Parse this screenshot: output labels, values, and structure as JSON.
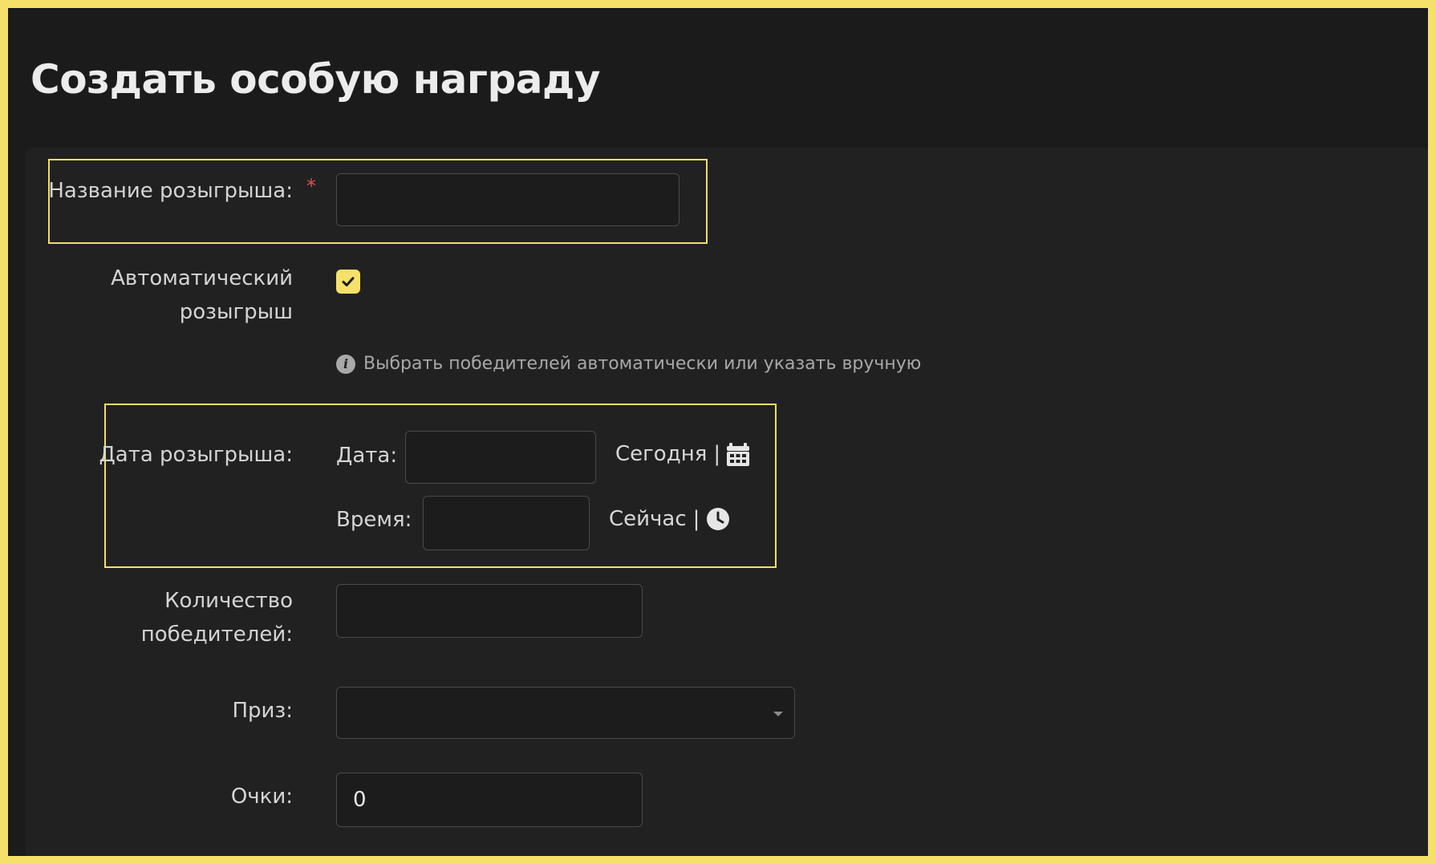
{
  "page": {
    "title": "Создать особую награду"
  },
  "form": {
    "name_label": "Название розыгрыша:",
    "required_mark": "*",
    "name_value": "",
    "auto_label_line1": "Автоматический",
    "auto_label_line2": "розыгрыш",
    "auto_checked": true,
    "auto_help": "Выбрать победителей автоматически или указать вручную",
    "draw_date_label": "Дата розыгрыша:",
    "date_label": "Дата:",
    "date_value": "",
    "today_link": "Сегодня",
    "separator": "|",
    "time_label": "Время:",
    "time_value": "",
    "now_link": "Сейчас",
    "winners_label_line1": "Количество",
    "winners_label_line2": "победителей:",
    "winners_value": "",
    "prize_label": "Приз:",
    "prize_value": "",
    "points_label": "Очки:",
    "points_value": "0"
  },
  "icons": {
    "calendar": "calendar-icon",
    "clock": "clock-icon",
    "info": "info-icon",
    "check": "check-icon",
    "dropdown": "chevron-down-icon"
  },
  "colors": {
    "accent": "#f5e16a",
    "highlight_border": "#f1df66",
    "background": "#1b1b1b",
    "panel": "#212121",
    "required": "#e05050"
  }
}
